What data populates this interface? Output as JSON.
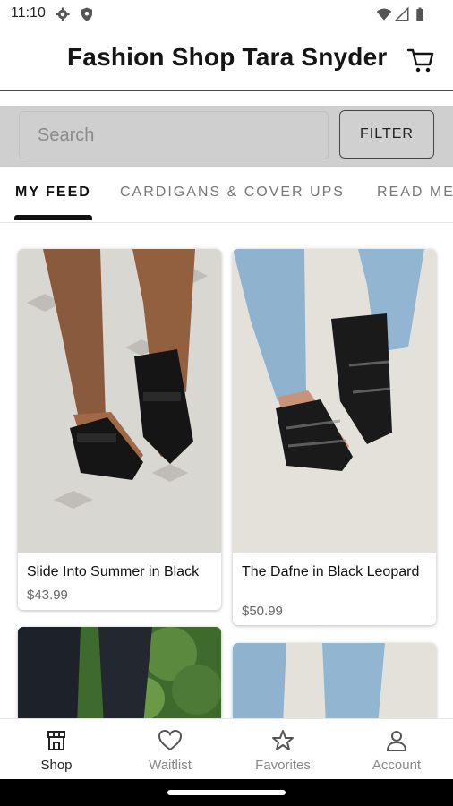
{
  "status_bar": {
    "time": "11:10"
  },
  "header": {
    "title": "Fashion Shop Tara Snyder",
    "cart_icon": "cart-icon"
  },
  "search": {
    "placeholder": "Search",
    "filter_label": "FILTER"
  },
  "tabs": [
    {
      "label": "MY FEED",
      "active": true
    },
    {
      "label": "CARDIGANS & COVER UPS",
      "active": false
    },
    {
      "label": "READ ME",
      "active": false
    }
  ],
  "products": [
    {
      "name": "Slide Into Summer in Black",
      "price": "$43.99"
    },
    {
      "name": "The Dafne in Black Leopard",
      "price": "$50.99"
    }
  ],
  "bottom_nav": [
    {
      "label": "Shop",
      "icon": "shop-icon",
      "active": true
    },
    {
      "label": "Waitlist",
      "icon": "heart-icon",
      "active": false
    },
    {
      "label": "Favorites",
      "icon": "star-icon",
      "active": false
    },
    {
      "label": "Account",
      "icon": "account-icon",
      "active": false
    }
  ],
  "colors": {
    "accent": "#111111",
    "search_bar_bg": "#cfcfcf",
    "system_nav": "#000000"
  }
}
